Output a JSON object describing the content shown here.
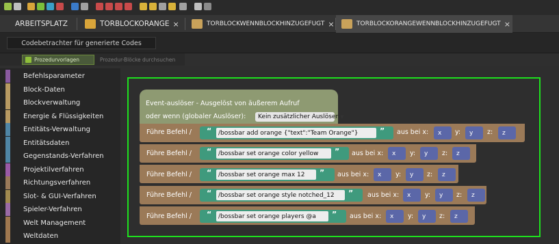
{
  "tabs": [
    {
      "label": "ARBEITSPLATZ",
      "closable": false
    },
    {
      "label": "TORBLOCKORANGE",
      "closable": true
    },
    {
      "label": "TORBLOCKWENNBLOCKHINZUGEFUGT",
      "closable": true
    },
    {
      "label": "TORBLOCKORANGEWENNBLOCKHINZUGEFUGT",
      "closable": true
    }
  ],
  "close_glyph": "×",
  "code_viewer": {
    "label": "Codebetrachter für generierte Codes"
  },
  "palette": {
    "tab_templates": "Prozedurvorlagen",
    "tab_search": "Prozedur-Blöcke durchsuchen"
  },
  "sidebar": {
    "items": [
      {
        "label": "Befehlsparameter",
        "color": "#8a5aa0"
      },
      {
        "label": "Block-Daten",
        "color": "#b89a62"
      },
      {
        "label": "Blockverwaltung",
        "color": "#b89a62"
      },
      {
        "label": "Energie & Flüssigkeiten",
        "color": "#b89a62"
      },
      {
        "label": "Entitäts-Verwaltung",
        "color": "#4f86a6"
      },
      {
        "label": "Entitätsdaten",
        "color": "#4f86a6"
      },
      {
        "label": "Gegenstands-Verfahren",
        "color": "#4f86a6"
      },
      {
        "label": "Projektilverfahren",
        "color": "#9a5aa6"
      },
      {
        "label": "Richtungsverfahren",
        "color": "#9a7a5a"
      },
      {
        "label": "Slot- & GUI-Verfahren",
        "color": "#a08a4f"
      },
      {
        "label": "Spieler-Verfahren",
        "color": "#9a6aa6"
      },
      {
        "label": "Welt Management",
        "color": "#a0784f"
      },
      {
        "label": "Weltdaten",
        "color": "#a0784f"
      }
    ]
  },
  "event_block": {
    "line1": "Event-auslöser - Ausgelöst von äußerem Aufruf",
    "line2": "oder wenn (globaler Auslöser):",
    "dropdown": "Kein zusätzlicher Auslöser",
    "dropdown_arrow": "▼"
  },
  "commands": [
    {
      "label": "Führe Befehl /",
      "string": "/bossbar add orange {\"text\":\"Team Orange\"}"
    },
    {
      "label": "Führe Befehl /",
      "string": "/bossbar set orange color yellow"
    },
    {
      "label": "Führe Befehl /",
      "string": "/bossbar set orange max 12"
    },
    {
      "label": "Führe Befehl /",
      "string": "/bossbar set orange style notched_12"
    },
    {
      "label": "Führe Befehl /",
      "string": "/bossbar set orange players @a"
    }
  ],
  "block_text": {
    "open_quote": "“",
    "close_quote": "”",
    "at_label": "aus bei x:",
    "x": "x",
    "y_label": "y:",
    "y": "y",
    "z_label": "z:",
    "z": "z"
  },
  "colors": {
    "highlight_frame": "#1ee01e",
    "string_block": "#3f9a7d",
    "coord_block": "#5b67a8",
    "command_block": "#9b7a58",
    "event_block": "#8e9a72"
  }
}
